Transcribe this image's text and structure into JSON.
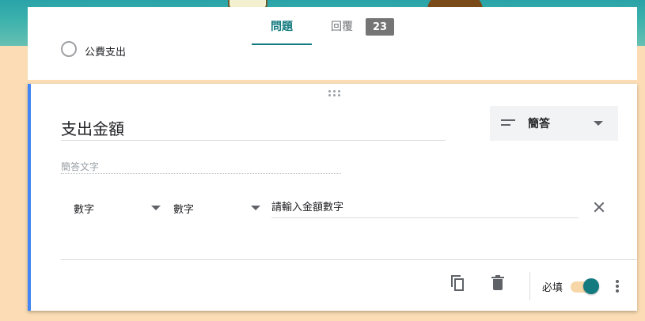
{
  "tabs": {
    "questions_label": "問題",
    "responses_label": "回覆",
    "responses_count": "23"
  },
  "previous_question": {
    "option_label": "公費支出"
  },
  "question": {
    "title": "支出金額",
    "type_label": "簡答",
    "answer_placeholder": "簡答文字",
    "validation": {
      "type_label": "數字",
      "condition_label": "數字",
      "error_text": "請輸入金額數字"
    },
    "required_label": "必填",
    "required": true
  },
  "colors": {
    "accent": "#137a7f",
    "active_border": "#4285f4",
    "page_background": "#fbdcb4"
  },
  "icons": [
    "drag-handle-icon",
    "short-answer-icon",
    "chevron-down-icon",
    "close-icon",
    "copy-icon",
    "delete-icon",
    "more-vert-icon"
  ]
}
